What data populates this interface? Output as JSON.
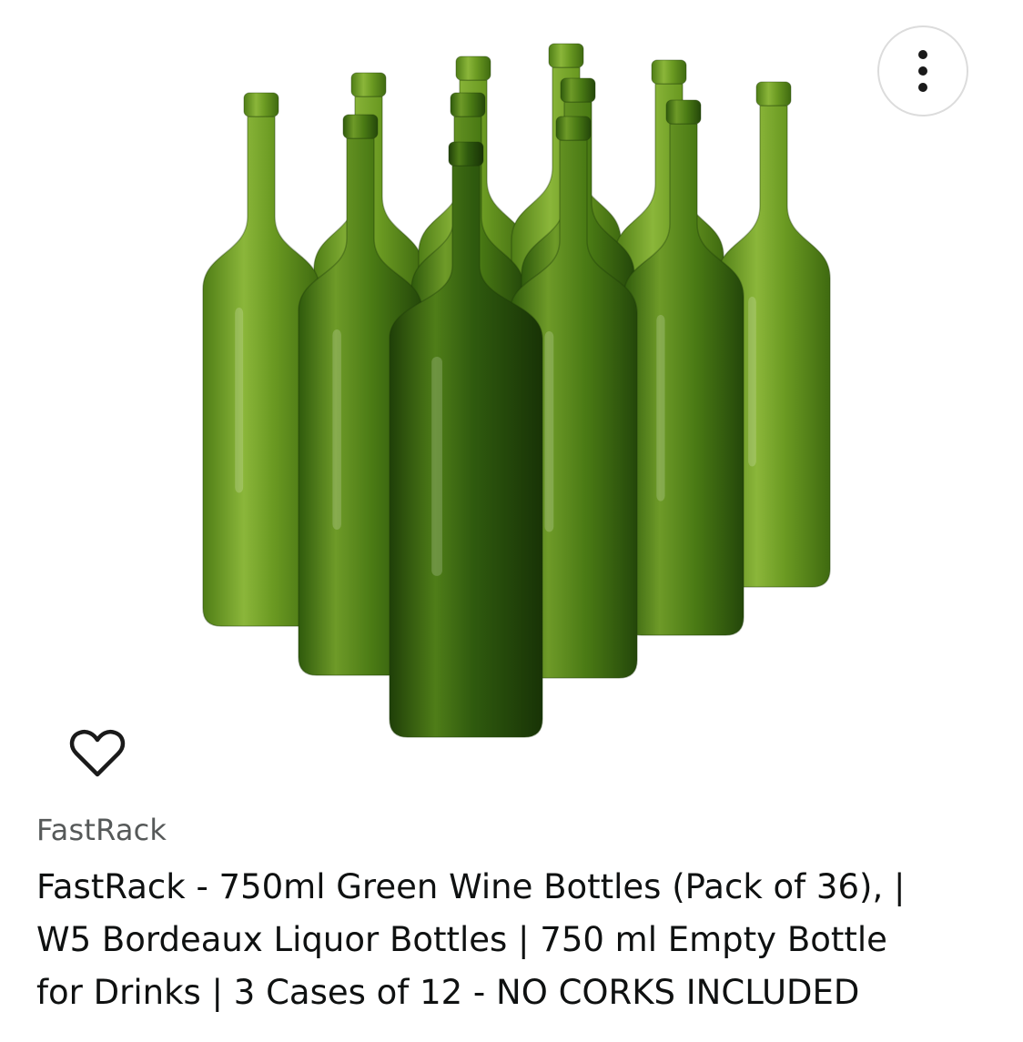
{
  "product": {
    "brand": "FastRack",
    "title_lines": [
      "FastRack - 750ml Green Wine Bottles (Pack of 36), |",
      "W5 Bordeaux Liquor Bottles | 750 ml Empty Bottle",
      "for Drinks | 3 Cases of 12 - NO CORKS INCLUDED"
    ]
  },
  "image": {
    "description_icon": "green-wine-bottles-image",
    "colors": {
      "bottle_light": "#6e9a2a",
      "bottle_mid": "#4a7a18",
      "bottle_dark": "#2a5410"
    }
  },
  "icons": {
    "more": "more-vertical-icon",
    "wishlist": "heart-outline-icon"
  }
}
